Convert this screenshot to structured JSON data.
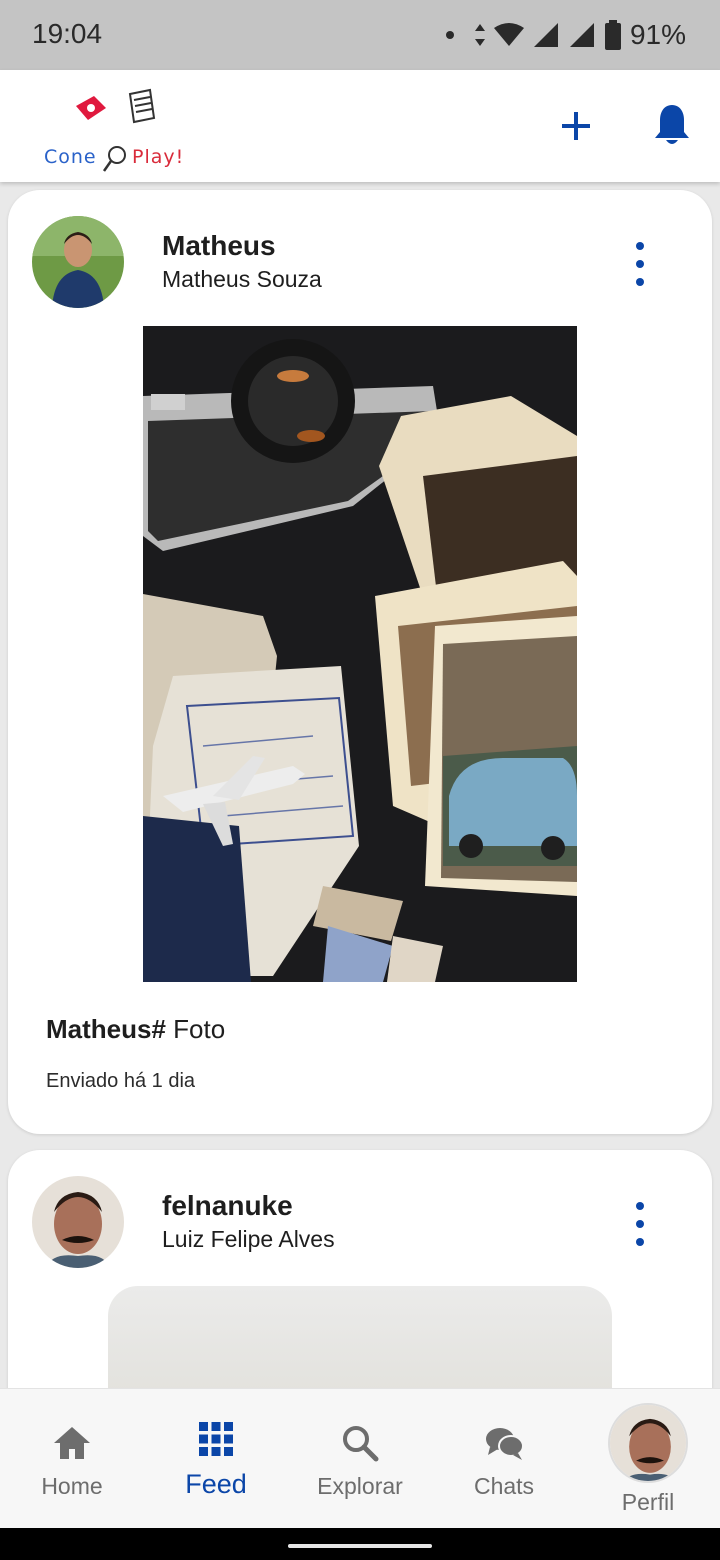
{
  "status_bar": {
    "time": "19:04",
    "battery": "91%"
  },
  "app": {
    "logo_left": "Cone",
    "logo_right": "Play!"
  },
  "posts": [
    {
      "username": "Matheus",
      "full_name": "Matheus Souza",
      "caption_user": "Matheus#",
      "caption_text": " Foto",
      "sent": "Enviado há 1 dia"
    },
    {
      "username": "felnanuke",
      "full_name": "Luiz Felipe Alves"
    }
  ],
  "bottom_nav": {
    "items": [
      {
        "label": "Home",
        "icon": "home-icon"
      },
      {
        "label": "Feed",
        "icon": "grid-icon",
        "active": true
      },
      {
        "label": "Explorar",
        "icon": "search-icon"
      },
      {
        "label": "Chats",
        "icon": "chat-bubbles-icon"
      },
      {
        "label": "Perfil",
        "icon": "avatar"
      }
    ]
  },
  "colors": {
    "accent": "#0b46a8",
    "inactive": "#6d6d6d",
    "status_bar_bg": "#c4c4c4"
  }
}
